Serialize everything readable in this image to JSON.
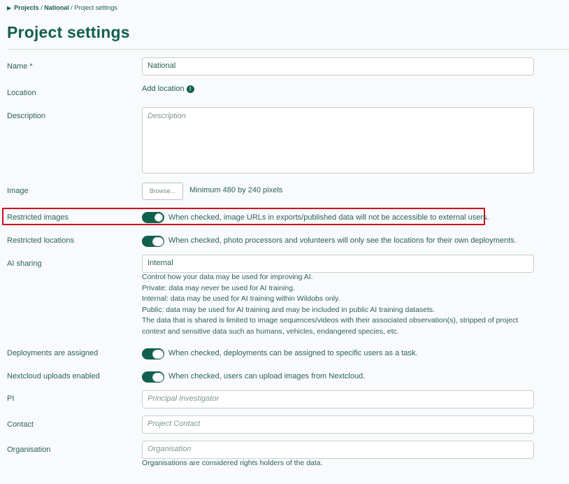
{
  "breadcrumb": {
    "item1": "Projects",
    "sep1": "/",
    "item2": "National",
    "sep2": "/",
    "current": "Project settings"
  },
  "page": {
    "title": "Project settings"
  },
  "form": {
    "name": {
      "label": "Name *",
      "value": "National"
    },
    "location": {
      "label": "Location",
      "link": "Add location",
      "info_icon": "!"
    },
    "description": {
      "label": "Description",
      "placeholder": "Description"
    },
    "image": {
      "label": "Image",
      "browse": "Browse...",
      "hint": "Minimum 480 by 240 pixels"
    },
    "restricted_images": {
      "label": "Restricted images",
      "checked": true,
      "desc": "When checked, image URLs in exports/published data will not be accessible to external users."
    },
    "restricted_locations": {
      "label": "Restricted locations",
      "checked": false,
      "desc": "When checked, photo processors and volunteers will only see the locations for their own deployments."
    },
    "ai_sharing": {
      "label": "AI sharing",
      "value": "Internal",
      "help": [
        "Control how your data may be used for improving AI.",
        "Private: data may never be used for AI training.",
        "Internal: data may be used for AI training within Wildobs only.",
        "Public: data may be used for AI training and may be included in public AI training datasets.",
        "The data that is shared is limited to image sequences/videos with their associated observation(s), stripped of project",
        "context and sensitive data such as humans, vehicles, endangered species, etc."
      ]
    },
    "deployments_assigned": {
      "label": "Deployments are assigned",
      "checked": false,
      "desc": "When checked, deployments can be assigned to specific users as a task."
    },
    "nextcloud": {
      "label": "Nextcloud uploads enabled",
      "checked": false,
      "desc": "When checked, users can upload images from Nextcloud."
    },
    "pi": {
      "label": "PI",
      "placeholder": "Principal Investigator"
    },
    "contact": {
      "label": "Contact",
      "placeholder": "Project Contact"
    },
    "organisation": {
      "label": "Organisation",
      "placeholder": "Organisation",
      "help": "Organisations are considered rights holders of the data."
    }
  },
  "colors": {
    "primary": "#11604f",
    "highlight": "#d10a1e",
    "background": "#f9fafc"
  }
}
